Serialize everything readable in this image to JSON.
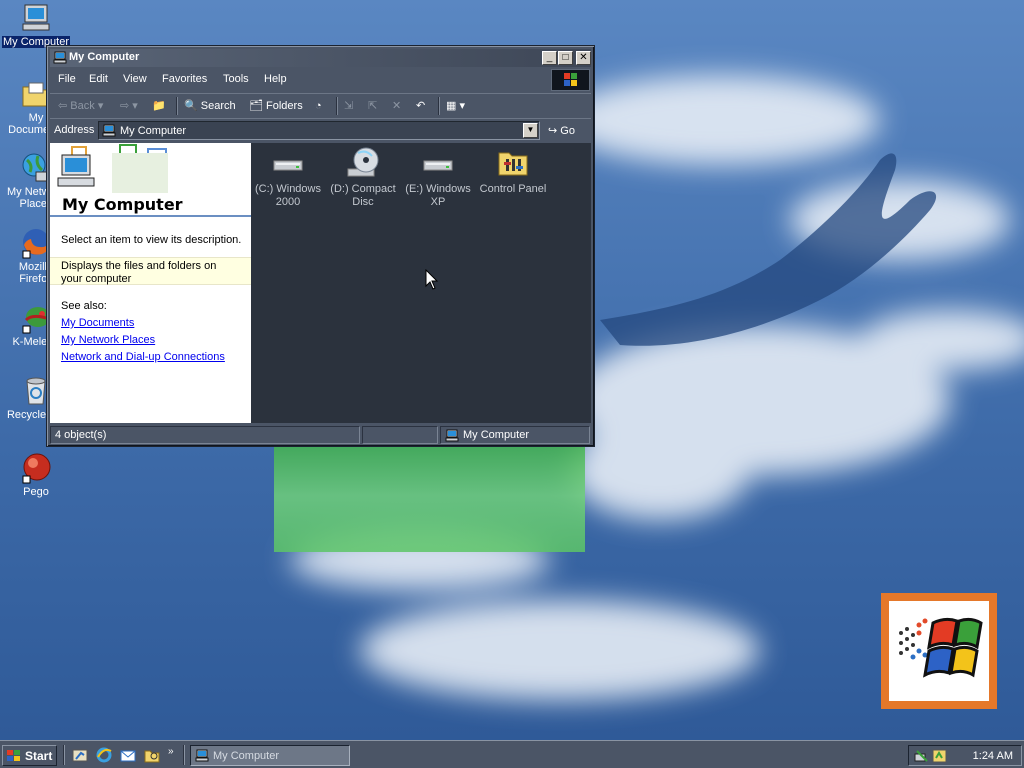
{
  "desktop": {
    "icons": [
      {
        "id": "my-computer",
        "label": "My Computer",
        "selected": true,
        "icon": "computer-icon"
      },
      {
        "id": "my-documents",
        "label": "My Documents",
        "icon": "folder-documents-icon"
      },
      {
        "id": "my-network-places",
        "label": "My Network Places",
        "icon": "network-globe-icon"
      },
      {
        "id": "mozilla-firefox",
        "label": "Mozilla Firefox",
        "icon": "firefox-icon"
      },
      {
        "id": "k-meleon",
        "label": "K-Meleon",
        "icon": "k-meleon-icon"
      },
      {
        "id": "recycle-bin",
        "label": "Recycle Bin",
        "icon": "recycle-bin-icon"
      },
      {
        "id": "pego",
        "label": "Pego",
        "icon": "pego-icon"
      }
    ],
    "brand_logo": "windows-2000-logo"
  },
  "window": {
    "title": "My Computer",
    "menu": [
      "File",
      "Edit",
      "View",
      "Favorites",
      "Tools",
      "Help"
    ],
    "toolbar": {
      "back": "Back",
      "search": "Search",
      "folders": "Folders"
    },
    "address": {
      "label": "Address",
      "value": "My Computer",
      "go": "Go"
    },
    "left_pane": {
      "title": "My Computer",
      "hint": "Select an item to view its description.",
      "description": "Displays the files and folders on your computer",
      "see_also_label": "See also:",
      "links": [
        "My Documents",
        "My Network Places",
        "Network and Dial-up Connections"
      ]
    },
    "items": [
      {
        "label": "(C:) Windows 2000",
        "icon": "hard-drive-icon"
      },
      {
        "label": "(D:) Compact Disc",
        "icon": "cd-drive-icon"
      },
      {
        "label": "(E:) Windows XP",
        "icon": "hard-drive-icon"
      },
      {
        "label": "Control Panel",
        "icon": "control-panel-folder-icon"
      }
    ],
    "status": {
      "objects": "4 object(s)",
      "zone": "My Computer"
    }
  },
  "taskbar": {
    "start": "Start",
    "quick_launch": [
      "show-desktop-icon",
      "internet-explorer-icon",
      "outlook-express-icon",
      "explorer-icon"
    ],
    "task_button": "My Computer",
    "clock": "1:24 AM"
  },
  "colors": {
    "window_bg": "#4b5566",
    "content_bg": "#2b323d",
    "desktop_sky": "#3f6fae",
    "link": "#0000ee"
  }
}
